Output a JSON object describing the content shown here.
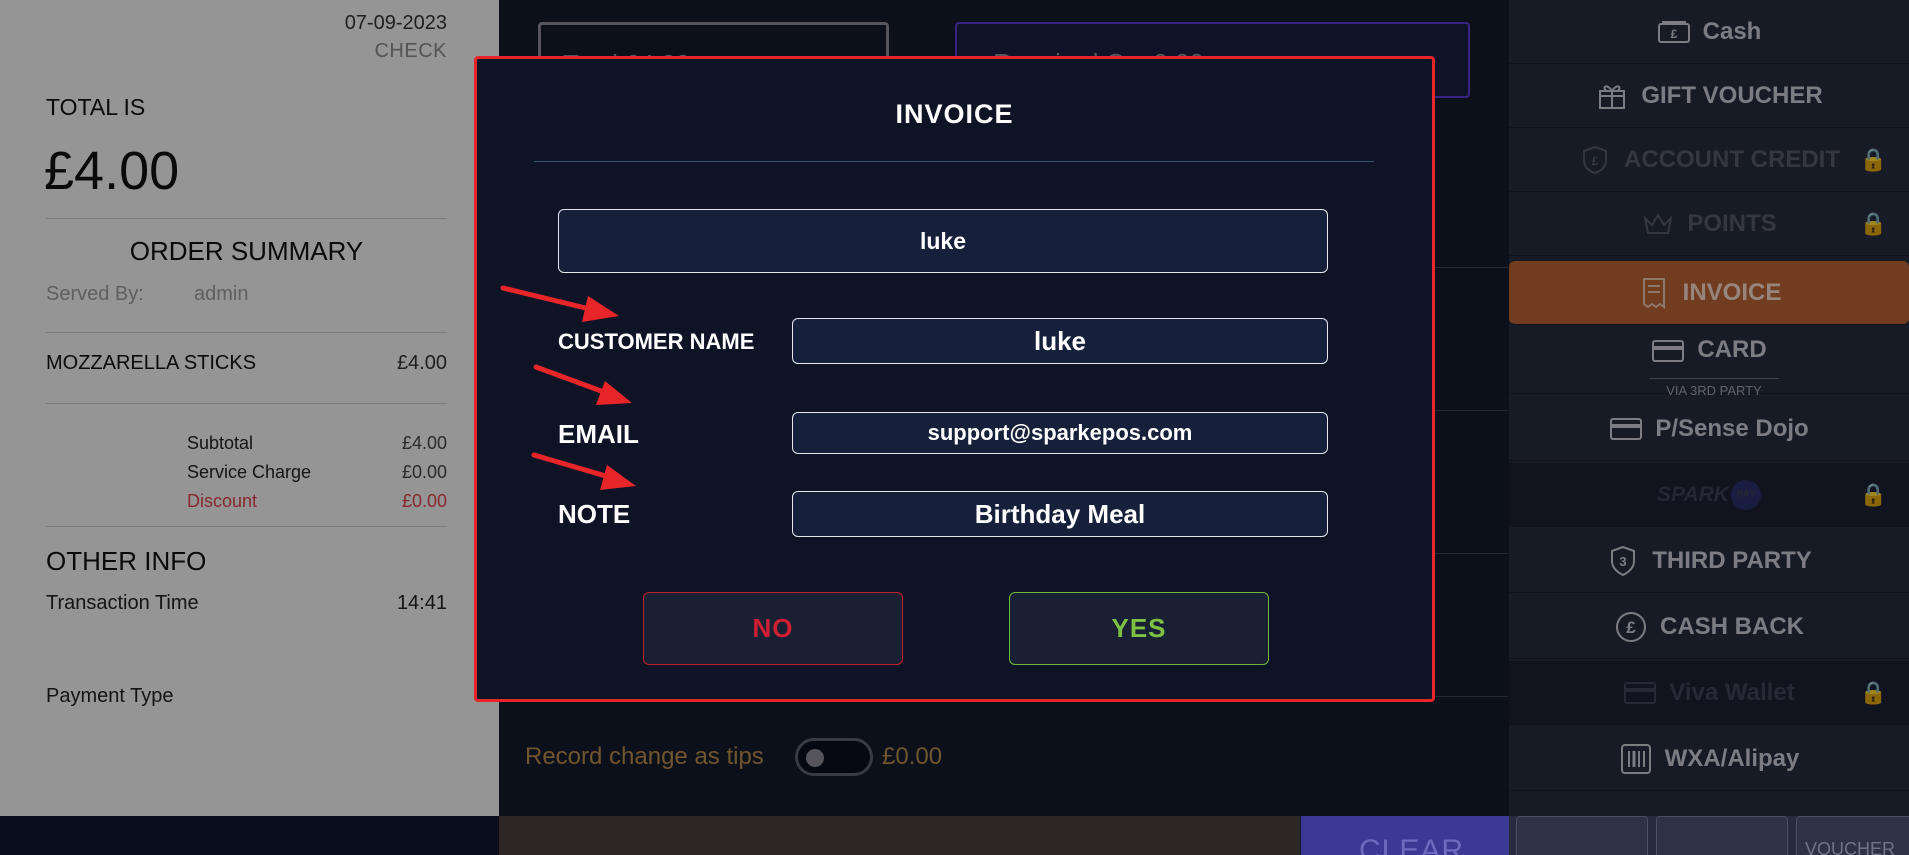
{
  "receipt": {
    "date": "07-09-2023",
    "check_label": "CHECK",
    "total_label": "TOTAL IS",
    "total_value": "£4.00",
    "summary_title": "ORDER SUMMARY",
    "served_by_label": "Served By:",
    "served_by_value": "admin",
    "items": [
      {
        "name": "MOZZARELLA STICKS",
        "price": "£4.00"
      }
    ],
    "subtotal_label": "Subtotal",
    "subtotal_value": "£4.00",
    "service_label": "Service Charge",
    "service_value": "£0.00",
    "discount_label": "Discount",
    "discount_value": "£0.00",
    "other_info_title": "OTHER INFO",
    "transaction_time_label": "Transaction Time",
    "transaction_time_value": "14:41",
    "payment_type_label": "Payment Type"
  },
  "middle": {
    "total_box_text": "Total        £4.00",
    "required_box_text": "Required C...        0.00",
    "tips_label": "Record change as tips",
    "tips_value": "£0.00",
    "clear_label": "CLEAR"
  },
  "payment_methods": [
    {
      "label": "Cash",
      "icon": "cash-icon",
      "state": "normal"
    },
    {
      "label": "GIFT VOUCHER",
      "icon": "gift-icon",
      "state": "normal"
    },
    {
      "label": "ACCOUNT CREDIT",
      "icon": "shield-pound-icon",
      "state": "locked"
    },
    {
      "label": "POINTS",
      "icon": "crown-icon",
      "state": "locked"
    },
    {
      "label": "INVOICE",
      "icon": "receipt-icon",
      "state": "active"
    },
    {
      "label": "CARD",
      "sublabel": "VIA 3RD PARTY",
      "icon": "card-icon",
      "state": "normal"
    },
    {
      "label": "P/Sense Dojo",
      "icon": "card-icon",
      "state": "normal"
    },
    {
      "label": "SPARK",
      "badge": "PAY",
      "icon": "spark-pay-logo",
      "state": "locked"
    },
    {
      "label": "THIRD PARTY",
      "icon": "shield-3-icon",
      "state": "normal"
    },
    {
      "label": "CASH BACK",
      "icon": "pound-circle-icon",
      "state": "normal"
    },
    {
      "label": "Viva Wallet",
      "icon": "card-icon",
      "state": "locked"
    },
    {
      "label": "WXA/Alipay",
      "icon": "barcode-icon",
      "state": "normal"
    }
  ],
  "payment_footer": {
    "voucher_label": "VOUCHER"
  },
  "modal": {
    "title": "INVOICE",
    "top_field_value": "luke",
    "customer_name_label": "CUSTOMER NAME",
    "customer_name_value": "luke",
    "email_label": "EMAIL",
    "email_value": "support@sparkepos.com",
    "note_label": "NOTE",
    "note_value": "Birthday Meal",
    "no_label": "NO",
    "yes_label": "YES"
  },
  "colors": {
    "modal_border": "#e8262a",
    "active_method": "#b76135",
    "no_button": "#d01f32",
    "yes_button": "#7cc242",
    "annotation_arrow": "#e8262a"
  }
}
